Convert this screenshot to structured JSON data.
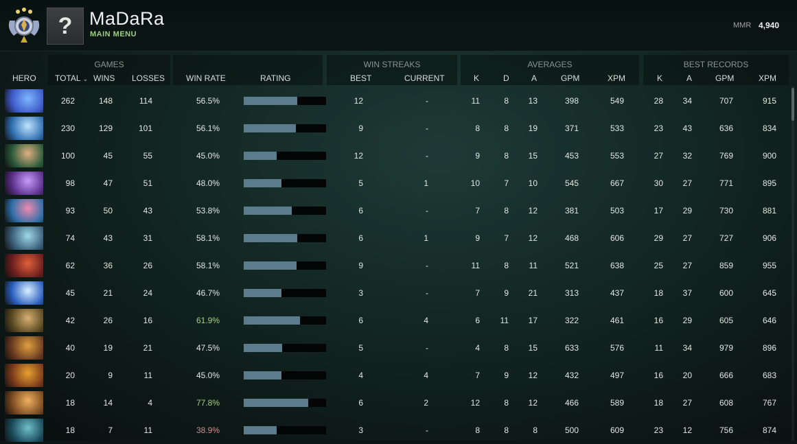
{
  "player": {
    "name": "MaDaRa",
    "subtitle": "MAIN MENU",
    "avatar_glyph": "?",
    "mmr_label": "MMR",
    "mmr_value": "4,940"
  },
  "groups": {
    "games": "GAMES",
    "win_streaks": "WIN STREAKS",
    "averages": "AVERAGES",
    "best_records": "BEST RECORDS"
  },
  "columns": {
    "hero": "HERO",
    "total": "TOTAL",
    "wins": "WINS",
    "losses": "LOSSES",
    "win_rate": "WIN RATE",
    "rating": "RATING",
    "streak_best": "BEST",
    "streak_current": "CURRENT",
    "avg_k": "K",
    "avg_d": "D",
    "avg_a": "A",
    "avg_gpm": "GPM",
    "avg_xpm": "XPM",
    "rec_k": "K",
    "rec_a": "A",
    "rec_gpm": "GPM",
    "rec_xpm": "XPM"
  },
  "colors": {
    "rating_bar": "#5a7c8c",
    "win_rate_high": "#a4cf87",
    "win_rate_low": "#cf8f90"
  },
  "rows": [
    {
      "hero_icon": "hero-portrait-icon",
      "colors": [
        "#3d5ac8",
        "#7fb7ff"
      ],
      "total": "262",
      "wins": "148",
      "losses": "114",
      "win_rate": "56.5%",
      "rating": 0.65,
      "best": "12",
      "current": "-",
      "k": "11",
      "d": "8",
      "a": "13",
      "gpm": "398",
      "xpm": "549",
      "rk": "28",
      "ra": "34",
      "rgpm": "707",
      "rxpm": "915",
      "tone": ""
    },
    {
      "hero_icon": "hero-portrait-icon",
      "colors": [
        "#2f6fb0",
        "#bfe3ff"
      ],
      "total": "230",
      "wins": "129",
      "losses": "101",
      "win_rate": "56.1%",
      "rating": 0.63,
      "best": "9",
      "current": "-",
      "k": "8",
      "d": "8",
      "a": "19",
      "gpm": "371",
      "xpm": "533",
      "rk": "23",
      "ra": "43",
      "rgpm": "636",
      "rxpm": "834",
      "tone": ""
    },
    {
      "hero_icon": "hero-portrait-icon",
      "colors": [
        "#2b5a3a",
        "#e0b080"
      ],
      "total": "100",
      "wins": "45",
      "losses": "55",
      "win_rate": "45.0%",
      "rating": 0.4,
      "best": "12",
      "current": "-",
      "k": "9",
      "d": "8",
      "a": "15",
      "gpm": "453",
      "xpm": "553",
      "rk": "27",
      "ra": "32",
      "rgpm": "769",
      "rxpm": "900",
      "tone": ""
    },
    {
      "hero_icon": "hero-portrait-icon",
      "colors": [
        "#5a2f8a",
        "#c59bff"
      ],
      "total": "98",
      "wins": "47",
      "losses": "51",
      "win_rate": "48.0%",
      "rating": 0.46,
      "best": "5",
      "current": "1",
      "k": "10",
      "d": "7",
      "a": "10",
      "gpm": "545",
      "xpm": "667",
      "rk": "30",
      "ra": "27",
      "rgpm": "771",
      "rxpm": "895",
      "tone": ""
    },
    {
      "hero_icon": "hero-portrait-icon",
      "colors": [
        "#2e6fa8",
        "#f08ab0"
      ],
      "total": "93",
      "wins": "50",
      "losses": "43",
      "win_rate": "53.8%",
      "rating": 0.58,
      "best": "6",
      "current": "-",
      "k": "7",
      "d": "8",
      "a": "12",
      "gpm": "381",
      "xpm": "503",
      "rk": "17",
      "ra": "29",
      "rgpm": "730",
      "rxpm": "881",
      "tone": ""
    },
    {
      "hero_icon": "hero-portrait-icon",
      "colors": [
        "#3a5e7a",
        "#9fd8e8"
      ],
      "total": "74",
      "wins": "43",
      "losses": "31",
      "win_rate": "58.1%",
      "rating": 0.65,
      "best": "6",
      "current": "1",
      "k": "9",
      "d": "7",
      "a": "12",
      "gpm": "468",
      "xpm": "606",
      "rk": "29",
      "ra": "27",
      "rgpm": "727",
      "rxpm": "906",
      "tone": ""
    },
    {
      "hero_icon": "hero-portrait-icon",
      "colors": [
        "#6a1e1e",
        "#e0603a"
      ],
      "total": "62",
      "wins": "36",
      "losses": "26",
      "win_rate": "58.1%",
      "rating": 0.64,
      "best": "9",
      "current": "-",
      "k": "11",
      "d": "8",
      "a": "11",
      "gpm": "521",
      "xpm": "638",
      "rk": "25",
      "ra": "27",
      "rgpm": "859",
      "rxpm": "955",
      "tone": ""
    },
    {
      "hero_icon": "hero-portrait-icon",
      "colors": [
        "#2a5fbf",
        "#d8f0ff"
      ],
      "total": "45",
      "wins": "21",
      "losses": "24",
      "win_rate": "46.7%",
      "rating": 0.46,
      "best": "3",
      "current": "-",
      "k": "7",
      "d": "9",
      "a": "21",
      "gpm": "313",
      "xpm": "437",
      "rk": "18",
      "ra": "37",
      "rgpm": "600",
      "rxpm": "645",
      "tone": ""
    },
    {
      "hero_icon": "hero-portrait-icon",
      "colors": [
        "#5a4a22",
        "#d8b070"
      ],
      "total": "42",
      "wins": "26",
      "losses": "16",
      "win_rate": "61.9%",
      "rating": 0.68,
      "best": "6",
      "current": "4",
      "k": "6",
      "d": "11",
      "a": "17",
      "gpm": "322",
      "xpm": "461",
      "rk": "16",
      "ra": "29",
      "rgpm": "605",
      "rxpm": "646",
      "tone": "good"
    },
    {
      "hero_icon": "hero-portrait-icon",
      "colors": [
        "#6a3a20",
        "#e0a040"
      ],
      "total": "40",
      "wins": "19",
      "losses": "21",
      "win_rate": "47.5%",
      "rating": 0.47,
      "best": "5",
      "current": "-",
      "k": "4",
      "d": "8",
      "a": "15",
      "gpm": "633",
      "xpm": "576",
      "rk": "11",
      "ra": "34",
      "rgpm": "979",
      "rxpm": "896",
      "tone": ""
    },
    {
      "hero_icon": "hero-portrait-icon",
      "colors": [
        "#7a3a1a",
        "#e8a030"
      ],
      "total": "20",
      "wins": "9",
      "losses": "11",
      "win_rate": "45.0%",
      "rating": 0.46,
      "best": "4",
      "current": "4",
      "k": "7",
      "d": "9",
      "a": "12",
      "gpm": "432",
      "xpm": "497",
      "rk": "16",
      "ra": "20",
      "rgpm": "666",
      "rxpm": "683",
      "tone": ""
    },
    {
      "hero_icon": "hero-portrait-icon",
      "colors": [
        "#7a4a20",
        "#f0b060"
      ],
      "total": "18",
      "wins": "14",
      "losses": "4",
      "win_rate": "77.8%",
      "rating": 0.78,
      "best": "6",
      "current": "2",
      "k": "12",
      "d": "8",
      "a": "12",
      "gpm": "466",
      "xpm": "589",
      "rk": "18",
      "ra": "27",
      "rgpm": "608",
      "rxpm": "767",
      "tone": "good"
    },
    {
      "hero_icon": "hero-portrait-icon",
      "colors": [
        "#1a4a5a",
        "#6fc0c8"
      ],
      "total": "18",
      "wins": "7",
      "losses": "11",
      "win_rate": "38.9%",
      "rating": 0.4,
      "best": "3",
      "current": "-",
      "k": "8",
      "d": "8",
      "a": "8",
      "gpm": "500",
      "xpm": "609",
      "rk": "23",
      "ra": "12",
      "rgpm": "756",
      "rxpm": "874",
      "tone": "bad"
    }
  ]
}
